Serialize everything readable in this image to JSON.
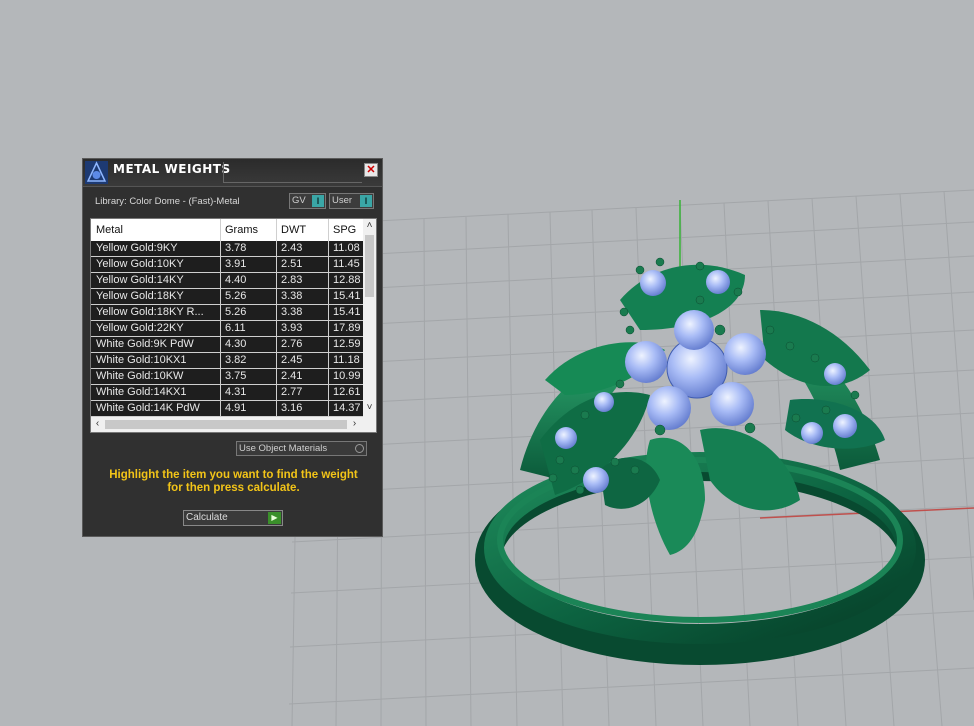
{
  "window": {
    "title": "METAL WEIGHTS",
    "close_icon": "close-icon",
    "app_icon": "jewelry-tool-icon"
  },
  "library": {
    "label": "Library: Color Dome - (Fast)-Metal",
    "gv_label": "GV",
    "user_label": "User",
    "toggle_glyph": "I"
  },
  "table": {
    "headers": [
      "Metal",
      "Grams",
      "DWT",
      "SPG"
    ],
    "rows": [
      {
        "metal": "Yellow Gold:9KY",
        "grams": "3.78",
        "dwt": "2.43",
        "spg": "11.08"
      },
      {
        "metal": "Yellow Gold:10KY",
        "grams": "3.91",
        "dwt": "2.51",
        "spg": "11.45"
      },
      {
        "metal": "Yellow Gold:14KY",
        "grams": "4.40",
        "dwt": "2.83",
        "spg": "12.88"
      },
      {
        "metal": "Yellow Gold:18KY",
        "grams": "5.26",
        "dwt": "3.38",
        "spg": "15.41"
      },
      {
        "metal": "Yellow Gold:18KY R...",
        "grams": "5.26",
        "dwt": "3.38",
        "spg": "15.41"
      },
      {
        "metal": "Yellow Gold:22KY",
        "grams": "6.11",
        "dwt": "3.93",
        "spg": "17.89"
      },
      {
        "metal": "White Gold:9K PdW",
        "grams": "4.30",
        "dwt": "2.76",
        "spg": "12.59"
      },
      {
        "metal": "White Gold:10KX1",
        "grams": "3.82",
        "dwt": "2.45",
        "spg": "11.18"
      },
      {
        "metal": "White Gold:10KW",
        "grams": "3.75",
        "dwt": "2.41",
        "spg": "10.99"
      },
      {
        "metal": "White Gold:14KX1",
        "grams": "4.31",
        "dwt": "2.77",
        "spg": "12.61"
      },
      {
        "metal": "White Gold:14K PdW",
        "grams": "4.91",
        "dwt": "3.16",
        "spg": "14.37"
      }
    ]
  },
  "options": {
    "use_object_materials": "Use Object Materials"
  },
  "instructions": {
    "line1": "Highlight the item you want to find the weight",
    "line2": "for then press calculate."
  },
  "calculate": {
    "label": "Calculate"
  },
  "colors": {
    "ring": "#0f6b45",
    "gem": "#9fb4f2",
    "viewport_bg": "#b4b7ba",
    "grid_line": "#9ea1a4",
    "accent_yellow": "#f2c418"
  }
}
